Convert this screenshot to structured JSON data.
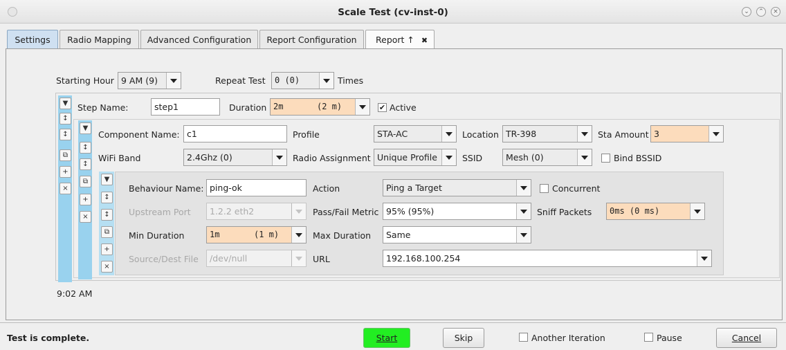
{
  "window": {
    "title": "Scale Test  (cv-inst-0)",
    "min_icon": "chevron-down-icon",
    "max_icon": "chevron-up-icon",
    "close_icon": "close-icon"
  },
  "tabs": [
    {
      "label": "Settings"
    },
    {
      "label": "Radio Mapping"
    },
    {
      "label": "Advanced Configuration"
    },
    {
      "label": "Report Configuration"
    },
    {
      "label": "Report ↑"
    }
  ],
  "tab_close": "✖",
  "top": {
    "starting_hour_label": "Starting Hour",
    "starting_hour_value": "9 AM (9)",
    "repeat_label": "Repeat Test",
    "repeat_value": "0 (0)",
    "times_label": "Times"
  },
  "step": {
    "name_label": "Step Name:",
    "name_value": "step1",
    "duration_label": "Duration",
    "duration_value": "2m",
    "duration_paren": "(2 m)",
    "active_label": "Active",
    "active_checked": true
  },
  "component": {
    "name_label": "Component Name:",
    "name_value": "c1",
    "profile_label": "Profile",
    "profile_value": "STA-AC",
    "location_label": "Location",
    "location_value": "TR-398",
    "sta_amount_label": "Sta Amount",
    "sta_amount_value": "3",
    "band_label": "WiFi Band",
    "band_value": "2.4Ghz (0)",
    "radio_label": "Radio Assignment",
    "radio_value": "Unique Profile",
    "ssid_label": "SSID",
    "ssid_value": "Mesh (0)",
    "bind_bssid_label": "Bind BSSID",
    "bind_bssid_checked": false
  },
  "behaviour": {
    "name_label": "Behaviour Name:",
    "name_value": "ping-ok",
    "action_label": "Action",
    "action_value": "Ping a Target",
    "concurrent_label": "Concurrent",
    "concurrent_checked": false,
    "upstream_label": "Upstream Port",
    "upstream_value": "1.2.2 eth2",
    "metric_label": "Pass/Fail Metric",
    "metric_value": "95% (95%)",
    "sniff_label": "Sniff Packets",
    "sniff_value": "0ms (0 ms)",
    "min_label": "Min Duration",
    "min_value": "1m",
    "min_paren": "(1 m)",
    "max_label": "Max Duration",
    "max_value": "Same",
    "file_label": "Source/Dest File",
    "file_value": "/dev/null",
    "url_label": "URL",
    "url_value": "192.168.100.254"
  },
  "side_icons": {
    "down": "▼",
    "move": "↕",
    "copy": "⧉",
    "add": "+",
    "remove": "×"
  },
  "clock": "9:02 AM",
  "statusbar": {
    "message": "Test is complete.",
    "start": "Start",
    "skip": "Skip",
    "another_label": "Another Iteration",
    "pause_label": "Pause",
    "cancel": "Cancel",
    "start_color": "#22ee22"
  }
}
